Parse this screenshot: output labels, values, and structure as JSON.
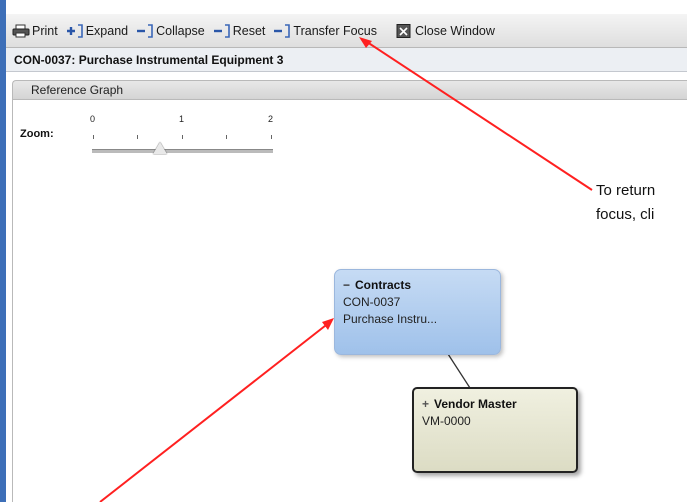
{
  "toolbar": {
    "items": [
      {
        "label": "Print",
        "icon": "printer-icon"
      },
      {
        "label": "Expand",
        "icon": "expand-icon"
      },
      {
        "label": "Collapse",
        "icon": "collapse-icon"
      },
      {
        "label": "Reset",
        "icon": "reset-icon"
      },
      {
        "label": "Transfer Focus",
        "icon": "transfer-focus-icon"
      },
      {
        "label": "Close Window",
        "icon": "close-window-icon"
      }
    ]
  },
  "window_title": "CON-0037: Purchase Instrumental Equipment 3",
  "panel": {
    "title": "Reference Graph"
  },
  "zoom": {
    "label": "Zoom:",
    "ticks": [
      "0",
      "1",
      "2"
    ],
    "value": 0.7
  },
  "annotation": {
    "line1": "To return",
    "line2": "focus, cli"
  },
  "nodes": {
    "contracts": {
      "collapse_symbol": "−",
      "title": "Contracts",
      "id": "CON-0037",
      "desc": "Purchase Instru..."
    },
    "vendor": {
      "expand_symbol": "+",
      "title": "Vendor Master",
      "id": "VM-0000"
    }
  },
  "colors": {
    "window_border": "#3d6fb8",
    "contracts_node": "#b3cff0",
    "vendor_node": "#e6e6d0",
    "annotation_arrow": "#ff2020"
  }
}
